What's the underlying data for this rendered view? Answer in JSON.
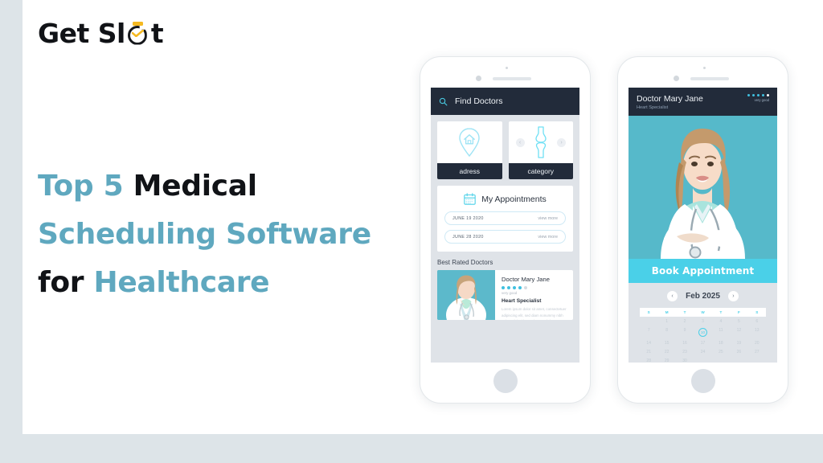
{
  "brand": {
    "name_before": "Get Sl",
    "name_after": "t",
    "mark_icon": "stopwatch-check-icon",
    "mark_color": "#f5b921"
  },
  "headline": {
    "line1_a": "Top 5 ",
    "line1_b": "Medical",
    "line2": "Scheduling Software",
    "line3_a": "for ",
    "line3_b": "Healthcare",
    "accent_color": "#5fa8bf",
    "dark_color": "#111317"
  },
  "phone1": {
    "search": {
      "icon": "search-icon",
      "placeholder": "Find Doctors",
      "value": "Find Doctors"
    },
    "cards": [
      {
        "icon": "home-pin-icon",
        "label": "adress"
      },
      {
        "icon": "knee-joint-icon",
        "label": "category",
        "prev": "‹",
        "next": "›"
      }
    ],
    "appointments": {
      "icon": "calendar-icon",
      "title": "My Appointments",
      "rows": [
        {
          "date": "JUNE 19 2020",
          "action": "view more"
        },
        {
          "date": "JUNE 28 2020",
          "action": "view more"
        }
      ]
    },
    "best_rated": {
      "section_title": "Best Rated Doctors",
      "doctor": {
        "photo": "doctor-portrait",
        "name": "Doctor Mary Jane",
        "rating_filled": 4,
        "rating_total": 5,
        "rating_caption": "very good",
        "specialty": "Heart Specialist",
        "description": "Lorem ipsum dolor sit amet, consectetuer adipiscing elit, sed diam nonummy nibh euismod tincidunt ut laoreet dolore."
      }
    }
  },
  "phone2": {
    "header": {
      "name": "Doctor Mary Jane",
      "specialty": "Heart Specialist",
      "rating_filled": 4,
      "rating_total": 5,
      "rating_caption": "very good"
    },
    "hero_photo": "doctor-portrait-large",
    "book_button": "Book Appointment",
    "calendar": {
      "prev": "‹",
      "next": "›",
      "month": "Feb 2025",
      "weekdays": [
        "S",
        "M",
        "T",
        "W",
        "T",
        "F",
        "S"
      ],
      "leading_blanks": 1,
      "days": [
        1,
        2,
        3,
        4,
        5,
        6,
        7,
        8,
        9,
        10,
        11,
        12,
        13,
        14,
        15,
        16,
        17,
        18,
        19,
        20,
        21,
        22,
        23,
        24,
        25,
        26,
        27,
        28,
        29,
        30
      ],
      "selected_day": 10,
      "accent_color": "#4ad0e8"
    }
  },
  "theme": {
    "page_background": "#dde4e8",
    "card_background": "#ffffff",
    "dark_ui": "#222b3a",
    "cyan": "#4ad0e8"
  }
}
